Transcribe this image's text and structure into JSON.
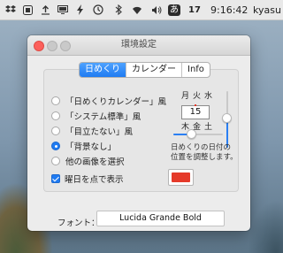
{
  "menubar": {
    "time": "9:16:42",
    "user": "kyasu",
    "calendar_day": "17",
    "input_method": "あ"
  },
  "window": {
    "title": "環境設定"
  },
  "tabs": [
    {
      "label": "日めくり",
      "active": true
    },
    {
      "label": "カレンダー",
      "active": false
    },
    {
      "label": "Info",
      "active": false
    }
  ],
  "styles": {
    "options": [
      {
        "label": "「日めくりカレンダー」風",
        "selected": false
      },
      {
        "label": "「システム標準」風",
        "selected": false
      },
      {
        "label": "「目立たない」風",
        "selected": false
      },
      {
        "label": "「背景なし」",
        "selected": true
      },
      {
        "label": "他の画像を選択",
        "selected": false
      }
    ]
  },
  "weekday_dot": {
    "label": "曜日を点で表示",
    "checked": true,
    "color": "#e53a2a"
  },
  "preview": {
    "top_weekdays": [
      "月",
      "火",
      "水"
    ],
    "bottom_weekdays": [
      "木",
      "金",
      "土"
    ],
    "date": "15",
    "note": "日めくりの日付の位置を調整します。"
  },
  "font": {
    "label": "フォント：",
    "value": "Lucida Grande Bold"
  },
  "colors": {
    "accent": "#1f7bf2",
    "close": "#fc605b"
  }
}
